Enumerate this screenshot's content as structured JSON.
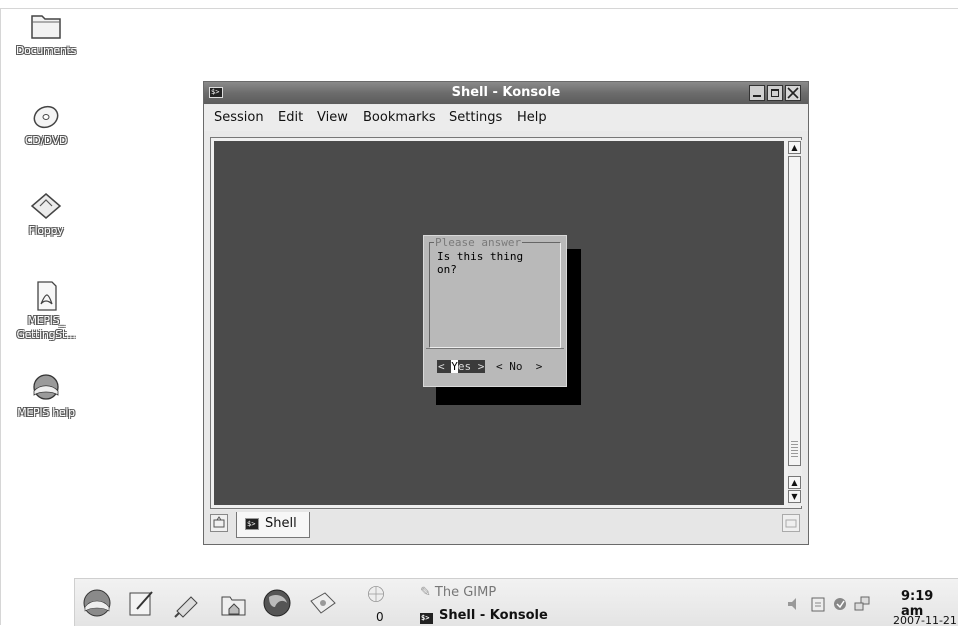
{
  "desktop": {
    "icons": [
      {
        "label": "Documents",
        "icon": "folder-icon"
      },
      {
        "label": "CD/DVD",
        "icon": "cd-icon"
      },
      {
        "label": "Floppy",
        "icon": "floppy-icon"
      },
      {
        "label_line1": "MEPIS_",
        "label_line2": "GettingSt...",
        "icon": "pdf-document-icon"
      },
      {
        "label": "MEPIS help",
        "icon": "help-globe-icon"
      }
    ]
  },
  "window": {
    "title": "Shell - Konsole",
    "menu": [
      "Session",
      "Edit",
      "View",
      "Bookmarks",
      "Settings",
      "Help"
    ],
    "dialog": {
      "title": "Please answer",
      "message_line1": "Is this thing",
      "message_line2": "on?",
      "yes_pre": "< ",
      "yes_cursor": "Y",
      "yes_post": "es >",
      "no_label": "< No  >"
    },
    "tab_label": "Shell"
  },
  "taskbar": {
    "desktop_number": "0",
    "tasks": [
      "The GIMP",
      "Shell - Konsole"
    ],
    "clock_time": "9:19 am",
    "clock_date": "2007-11-21"
  },
  "colors": {
    "terminal_bg": "#4b4b4b",
    "dialog_bg": "#b9b9b9",
    "titlebar": "#6c6c6c"
  }
}
